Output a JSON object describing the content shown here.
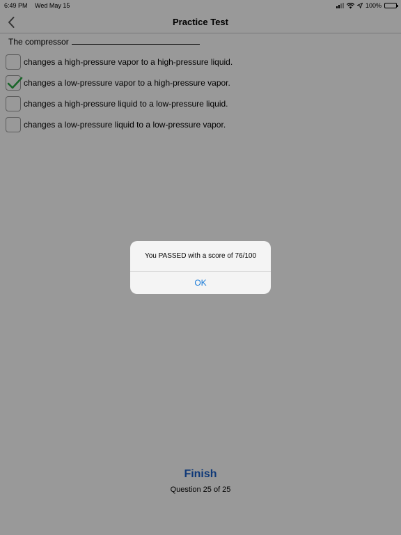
{
  "status_bar": {
    "time": "6:49 PM",
    "date": "Wed May 15",
    "battery": "100%",
    "icons": [
      "signal-icon",
      "wifi-icon",
      "location-icon",
      "battery-icon"
    ]
  },
  "nav": {
    "title": "Practice Test",
    "back_icon": "chevron-left-icon"
  },
  "question": {
    "stem": "The compressor",
    "options": [
      {
        "label": "changes a high-pressure vapor to a high-pressure liquid.",
        "checked": false
      },
      {
        "label": "changes a low-pressure vapor to a high-pressure vapor.",
        "checked": true
      },
      {
        "label": "changes a high-pressure liquid to a low-pressure liquid.",
        "checked": false
      },
      {
        "label": "changes a low-pressure liquid to a low-pressure vapor.",
        "checked": false
      }
    ]
  },
  "footer": {
    "finish_label": "Finish",
    "counter": "Question 25 of 25"
  },
  "alert": {
    "message": "You PASSED with a score of 76/100",
    "ok_label": "OK"
  },
  "colors": {
    "accent": "#1a5fc8",
    "check": "#2aa845",
    "alert_button": "#1a7bd8"
  }
}
